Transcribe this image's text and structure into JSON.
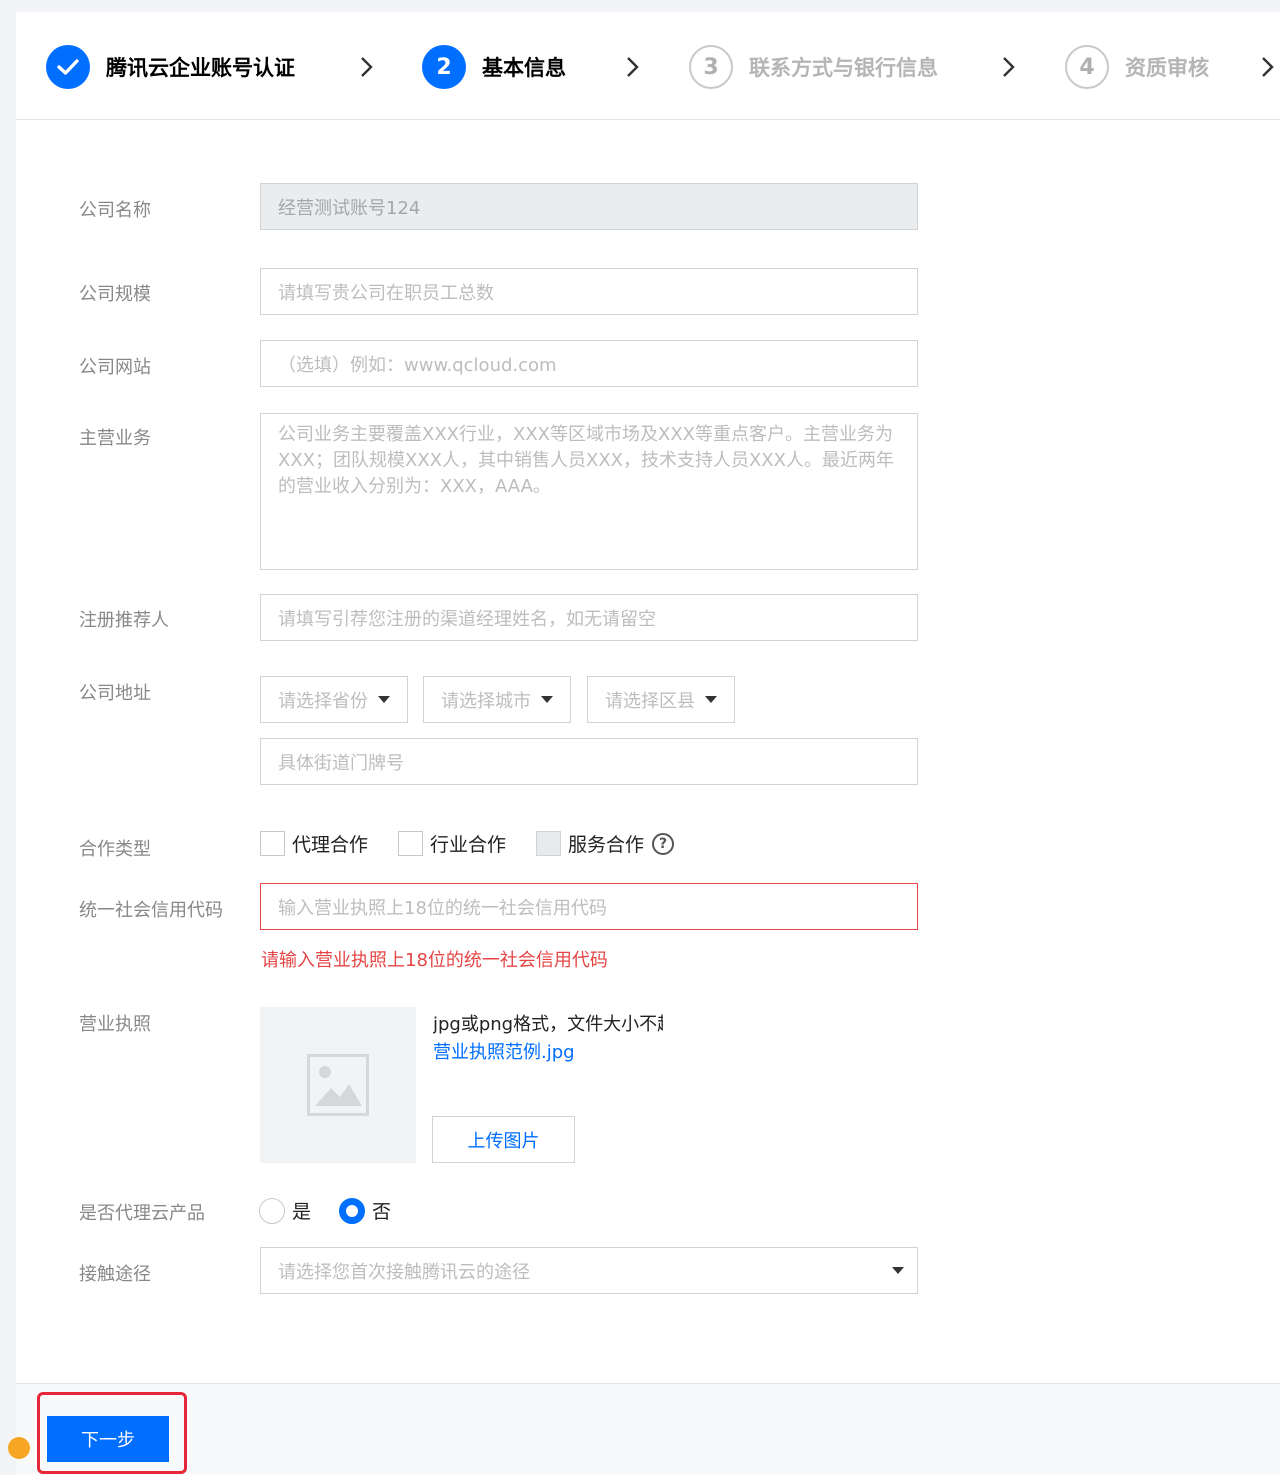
{
  "steps": [
    {
      "number": "",
      "label": "腾讯云企业账号认证",
      "state": "done"
    },
    {
      "number": "2",
      "label": "基本信息",
      "state": "active"
    },
    {
      "number": "3",
      "label": "联系方式与银行信息",
      "state": "pending"
    },
    {
      "number": "4",
      "label": "资质审核",
      "state": "pending"
    }
  ],
  "form": {
    "company_name": {
      "label": "公司名称",
      "value": "经营测试账号124"
    },
    "company_size": {
      "label": "公司规模",
      "placeholder": "请填写贵公司在职员工总数"
    },
    "website": {
      "label": "公司网站",
      "placeholder": "（选填）例如：www.qcloud.com"
    },
    "main_business": {
      "label": "主营业务",
      "placeholder": "公司业务主要覆盖XXX行业，XXX等区域市场及XXX等重点客户。主营业务为XXX；团队规模XXX人，其中销售人员XXX，技术支持人员XXX人。最近两年的营业收入分别为：XXX，AAA。"
    },
    "referrer": {
      "label": "注册推荐人",
      "placeholder": "请填写引荐您注册的渠道经理姓名，如无请留空"
    },
    "address": {
      "label": "公司地址",
      "province": "请选择省份",
      "city": "请选择城市",
      "district": "请选择区县",
      "street_placeholder": "具体街道门牌号"
    },
    "cooperation": {
      "label": "合作类型",
      "options": [
        "代理合作",
        "行业合作",
        "服务合作"
      ],
      "help": "?"
    },
    "credit_code": {
      "label": "统一社会信用代码",
      "placeholder": "输入营业执照上18位的统一社会信用代码",
      "error": "请输入营业执照上18位的统一社会信用代码"
    },
    "license": {
      "label": "营业执照",
      "hint": "jpg或png格式，文件大小不超过",
      "example_link": "营业执照范例.jpg",
      "upload_label": "上传图片"
    },
    "agent_product": {
      "label": "是否代理云产品",
      "options": [
        "是",
        "否"
      ],
      "selected": "否"
    },
    "contact_channel": {
      "label": "接触途径",
      "placeholder": "请选择您首次接触腾讯云的途径"
    }
  },
  "footer": {
    "next_label": "下一步"
  },
  "colors": {
    "primary": "#006eff",
    "error": "#e54545",
    "highlight": "#e8263a"
  }
}
